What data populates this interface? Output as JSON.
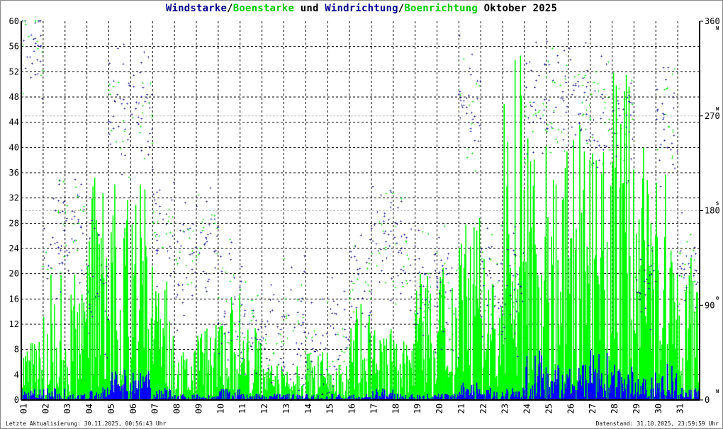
{
  "title": {
    "parts": [
      {
        "text": "Windstarke",
        "color": "#00008b"
      },
      {
        "text": "/",
        "color": "#000000"
      },
      {
        "text": "Boenstarke",
        "color": "#00c800"
      },
      {
        "text": " und ",
        "color": "#000000"
      },
      {
        "text": "Windrichtung",
        "color": "#00008b"
      },
      {
        "text": "/",
        "color": "#000000"
      },
      {
        "text": "Boenrichtung",
        "color": "#00c800"
      },
      {
        "text": " Oktober 2025",
        "color": "#000000"
      }
    ]
  },
  "footer": {
    "left": "Letzte Aktualisierung: 30.11.2025, 00:56:43 Uhr",
    "right": "Datenstand: 31.10.2025, 23:59:59 Uhr"
  },
  "chart_data": {
    "type": "scatter",
    "title": "Windstarke/Boenstarke und Windrichtung/Boenrichtung Oktober 2025",
    "x_categories": [
      "01",
      "02",
      "03",
      "04",
      "05",
      "06",
      "07",
      "08",
      "09",
      "10",
      "11",
      "12",
      "13",
      "14",
      "15",
      "16",
      "17",
      "18",
      "19",
      "20",
      "21",
      "22",
      "23",
      "24",
      "25",
      "26",
      "27",
      "28",
      "29",
      "30",
      "31"
    ],
    "y_left": {
      "min": 0,
      "max": 60,
      "step": 4,
      "ticks": [
        "0",
        "4",
        "8",
        "12",
        "16",
        "20",
        "24",
        "28",
        "32",
        "36",
        "40",
        "44",
        "48",
        "52",
        "56",
        "60"
      ]
    },
    "y_right": {
      "min": 0,
      "max": 360,
      "ticks": [
        "0",
        "90",
        "180",
        "270",
        "360"
      ],
      "direction_labels": [
        {
          "deg": 360,
          "label": "N"
        },
        {
          "deg": 270,
          "label": "W"
        },
        {
          "deg": 180,
          "label": "S"
        },
        {
          "deg": 90,
          "label": "O"
        },
        {
          "deg": 0,
          "label": "N"
        }
      ]
    },
    "grid": true,
    "colors": {
      "wind": "#0000ff",
      "gust": "#00ff00",
      "wind_dir": "#00008b",
      "gust_dir": "#00e000",
      "grid": "#000000",
      "ref": "#c8c8c8"
    },
    "series": [
      {
        "name": "Windstarke (daily max)",
        "values": [
          2,
          2,
          1,
          2,
          6,
          5,
          2,
          1,
          1,
          2,
          1,
          1,
          1,
          1,
          1,
          1,
          2,
          1,
          1,
          1,
          3,
          2,
          2,
          9,
          6,
          6,
          8,
          6,
          5,
          6,
          2
        ]
      },
      {
        "name": "Boenstarke (daily max)",
        "values": [
          10,
          20,
          20,
          36,
          36,
          36,
          20,
          8,
          12,
          18,
          12,
          6,
          8,
          8,
          6,
          16,
          12,
          10,
          20,
          24,
          32,
          24,
          56,
          56,
          40,
          44,
          40,
          56,
          40,
          36,
          24
        ]
      },
      {
        "name": "Windrichtung (daily typical, deg)",
        "values": [
          342,
          156,
          162,
          108,
          276,
          276,
          162,
          126,
          150,
          90,
          72,
          48,
          72,
          30,
          66,
          108,
          156,
          132,
          108,
          108,
          276,
          108,
          108,
          276,
          276,
          276,
          270,
          264,
          108,
          270,
          120
        ]
      }
    ]
  }
}
